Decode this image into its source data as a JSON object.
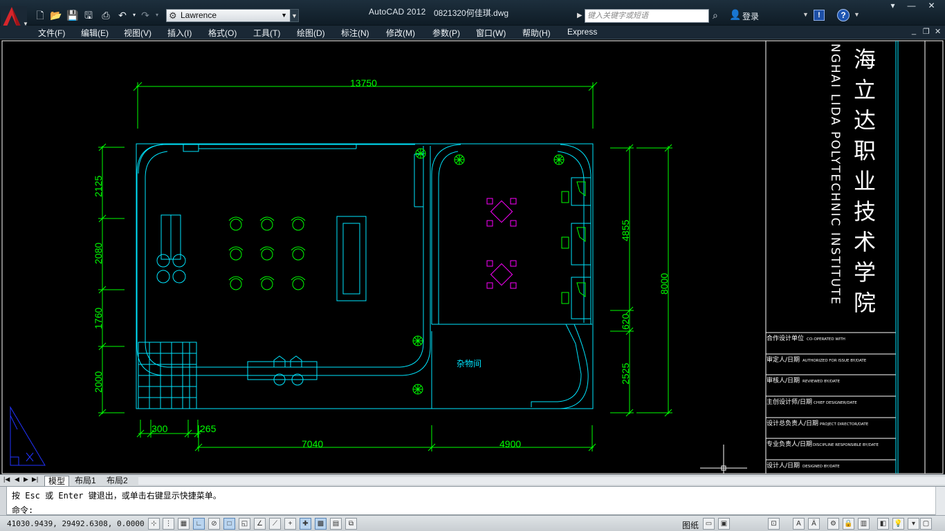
{
  "titlebar": {
    "app_name": "AutoCAD 2012",
    "file_name": "0821320何佳琪.dwg",
    "workspace": "Lawrence",
    "search_placeholder": "键入关键字或短语",
    "login_label": "登录"
  },
  "menu": [
    {
      "label": "文件(F)"
    },
    {
      "label": "编辑(E)"
    },
    {
      "label": "视图(V)"
    },
    {
      "label": "插入(I)"
    },
    {
      "label": "格式(O)"
    },
    {
      "label": "工具(T)"
    },
    {
      "label": "绘图(D)"
    },
    {
      "label": "标注(N)"
    },
    {
      "label": "修改(M)"
    },
    {
      "label": "参数(P)"
    },
    {
      "label": "窗口(W)"
    },
    {
      "label": "帮助(H)"
    },
    {
      "label": "Express"
    }
  ],
  "drawing": {
    "dimensions": {
      "top_total": "13750",
      "left_1": "2125",
      "left_2": "2080",
      "left_3": "1760",
      "left_4": "2000",
      "right_1": "4855",
      "right_2": "620",
      "right_3": "2525",
      "right_total": "8000",
      "bottom_1": "300",
      "bottom_2": "265",
      "bottom_3": "7040",
      "bottom_4": "4900"
    },
    "room_label": "杂物间",
    "title_block": {
      "school_cn": "海立达职业技术学院",
      "school_en": "NGHAI LIDA POLYTECHNIC INSTITUTE",
      "rows": [
        {
          "cn": "合作设计单位",
          "en": "CO-OPERATED WITH"
        },
        {
          "cn": "审定人/日期",
          "en": "AUTHORIZED FOR ISSUE BY/DATE"
        },
        {
          "cn": "审核人/日期",
          "en": "REVIEWED BY/DATE"
        },
        {
          "cn": "主创设计师/日期",
          "en": "CHIEF DESIGNER/DATE"
        },
        {
          "cn": "设计总负责人/日期",
          "en": "PROJECT DIRECTOR/DATE"
        },
        {
          "cn": "专业负责人/日期",
          "en": "DISCIPLINE RESPONSIBLE BY/DATE"
        },
        {
          "cn": "设计人/日期",
          "en": "DESIGNED BY/DATE"
        }
      ]
    }
  },
  "tabs": {
    "model": "模型",
    "layout1": "布局1",
    "layout2": "布局2"
  },
  "command": {
    "history": "按 Esc 或 Enter 键退出，或单击右键显示快捷菜单。",
    "prompt": "命令:"
  },
  "status": {
    "coordinates": "41030.9439, 29492.6308, 0.0000",
    "paper_label": "图纸"
  },
  "colors": {
    "wall": "#00e6ff",
    "dimension": "#00ff00",
    "furniture": "#00ff00",
    "chairs_magenta": "#ff00ff",
    "text_white": "#ffffff"
  }
}
